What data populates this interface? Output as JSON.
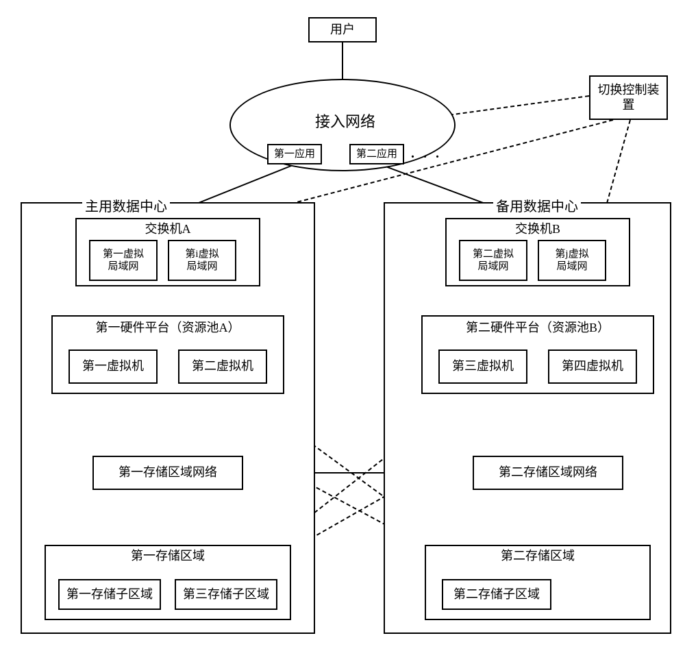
{
  "user": "用户",
  "switch_control": "切换控制装\n置",
  "access_network": "接入网络",
  "app1": "第一应用",
  "app2": "第二应用",
  "dots": ". . .",
  "primary_dc": {
    "title": "主用数据中心",
    "switch": "交换机A",
    "vlan1": "第一虚拟\n局域网",
    "vlan_i": "第i虚拟\n局域网",
    "hw_platform": "第一硬件平台（资源池A）",
    "vm1": "第一虚拟机",
    "vm2": "第二虚拟机",
    "san": "第一存储区域网络",
    "storage_area": "第一存储区域",
    "sub1": "第一存储子区域",
    "sub3": "第三存储子区域"
  },
  "backup_dc": {
    "title": "备用数据中心",
    "switch": "交换机B",
    "vlan2": "第二虚拟\n局域网",
    "vlan_j": "第j虚拟\n局域网",
    "hw_platform": "第二硬件平台（资源池B）",
    "vm3": "第三虚拟机",
    "vm4": "第四虚拟机",
    "san": "第二存储区域网络",
    "storage_area": "第二存储区域",
    "sub2": "第二存储子区域"
  },
  "chart_data": {
    "type": "diagram",
    "title": "Primary/Backup Data Center Architecture",
    "nodes": [
      {
        "id": "user",
        "label": "用户"
      },
      {
        "id": "switch_control",
        "label": "切换控制装置"
      },
      {
        "id": "access_network",
        "label": "接入网络",
        "children": [
          "app1",
          "app2"
        ]
      },
      {
        "id": "app1",
        "label": "第一应用"
      },
      {
        "id": "app2",
        "label": "第二应用"
      },
      {
        "id": "primary_dc",
        "label": "主用数据中心",
        "children": [
          "switchA",
          "hw_platform_A",
          "san1",
          "storage1"
        ]
      },
      {
        "id": "switchA",
        "label": "交换机A",
        "children": [
          "vlan1",
          "vlan_i"
        ]
      },
      {
        "id": "vlan1",
        "label": "第一虚拟局域网"
      },
      {
        "id": "vlan_i",
        "label": "第i虚拟局域网"
      },
      {
        "id": "hw_platform_A",
        "label": "第一硬件平台（资源池A）",
        "children": [
          "vm1",
          "vm2"
        ]
      },
      {
        "id": "vm1",
        "label": "第一虚拟机"
      },
      {
        "id": "vm2",
        "label": "第二虚拟机"
      },
      {
        "id": "san1",
        "label": "第一存储区域网络"
      },
      {
        "id": "storage1",
        "label": "第一存储区域",
        "children": [
          "sub1",
          "sub3"
        ]
      },
      {
        "id": "sub1",
        "label": "第一存储子区域"
      },
      {
        "id": "sub3",
        "label": "第三存储子区域"
      },
      {
        "id": "backup_dc",
        "label": "备用数据中心",
        "children": [
          "switchB",
          "hw_platform_B",
          "san2",
          "storage2"
        ]
      },
      {
        "id": "switchB",
        "label": "交换机B",
        "children": [
          "vlan2",
          "vlan_j"
        ]
      },
      {
        "id": "vlan2",
        "label": "第二虚拟局域网"
      },
      {
        "id": "vlan_j",
        "label": "第j虚拟局域网"
      },
      {
        "id": "hw_platform_B",
        "label": "第二硬件平台（资源池B）",
        "children": [
          "vm3",
          "vm4"
        ]
      },
      {
        "id": "vm3",
        "label": "第三虚拟机"
      },
      {
        "id": "vm4",
        "label": "第四虚拟机"
      },
      {
        "id": "san2",
        "label": "第二存储区域网络"
      },
      {
        "id": "storage2",
        "label": "第二存储区域",
        "children": [
          "sub2"
        ]
      },
      {
        "id": "sub2",
        "label": "第二存储子区域"
      }
    ],
    "edges_solid": [
      [
        "user",
        "access_network"
      ],
      [
        "app1",
        "app2"
      ],
      [
        "app1",
        "switchA"
      ],
      [
        "app2",
        "switchB"
      ],
      [
        "hw_platform_A",
        "san1"
      ],
      [
        "san1",
        "storage1"
      ],
      [
        "san1",
        "san2"
      ],
      [
        "hw_platform_B",
        "san2"
      ],
      [
        "san2",
        "storage2"
      ]
    ],
    "edges_dashed": [
      [
        "switch_control",
        "access_network"
      ],
      [
        "switch_control",
        "switchA"
      ],
      [
        "switch_control",
        "switchB"
      ],
      [
        "vlan1",
        "vm1"
      ],
      [
        "vlan1",
        "vm2"
      ],
      [
        "vlan_i",
        "vm1"
      ],
      [
        "vlan_i",
        "vm2"
      ],
      [
        "vlan2",
        "vm3"
      ],
      [
        "vlan2",
        "vm4"
      ],
      [
        "vlan_j",
        "vm3"
      ],
      [
        "vlan_j",
        "vm4"
      ],
      [
        "vm1",
        "sub1"
      ],
      [
        "vm2",
        "sub1"
      ],
      [
        "vm1",
        "sub2"
      ],
      [
        "vm2",
        "sub2"
      ],
      [
        "vm3",
        "sub3"
      ],
      [
        "vm4",
        "sub3"
      ]
    ]
  }
}
